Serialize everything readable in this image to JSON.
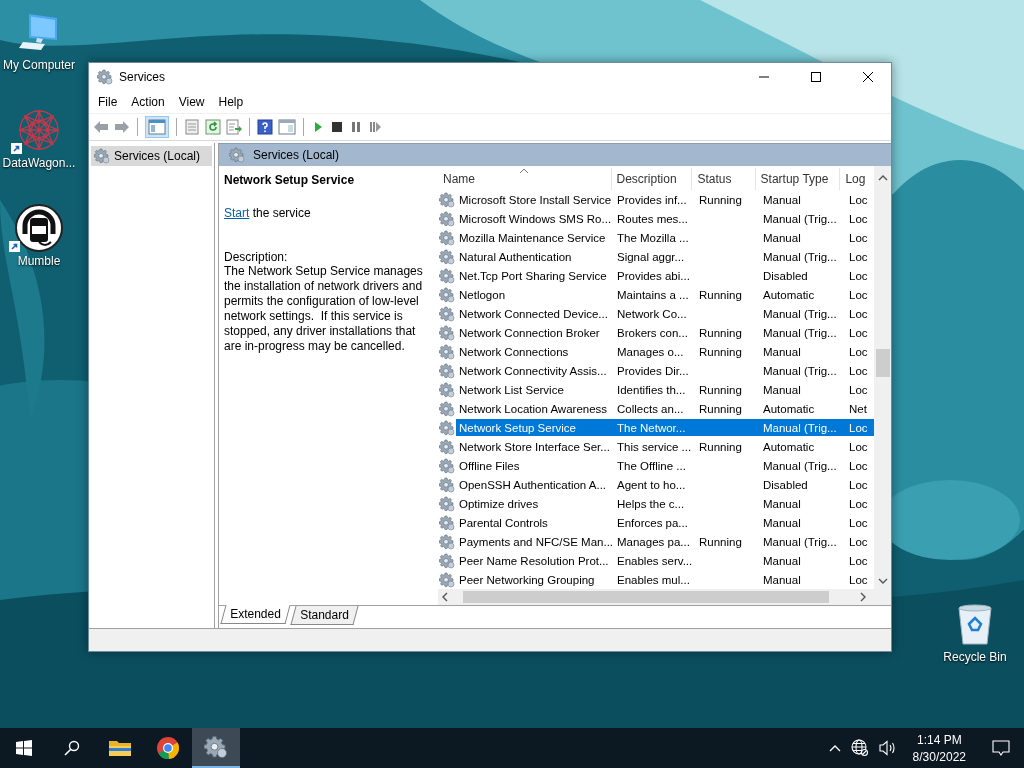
{
  "desktop_icons": [
    {
      "label": "My Computer",
      "kind": "computer",
      "shortcut": false
    },
    {
      "label": "DataWagon...",
      "kind": "mesh",
      "shortcut": true
    },
    {
      "label": "Mumble",
      "kind": "headset",
      "shortcut": true
    }
  ],
  "recycle_bin": {
    "label": "Recycle Bin",
    "kind": "bin"
  },
  "window": {
    "title": "Services",
    "menu": [
      "File",
      "Action",
      "View",
      "Help"
    ],
    "tree": [
      {
        "label": "Services (Local)",
        "selected": true
      }
    ],
    "pane_header": "Services (Local)",
    "detail": {
      "title": "Network Setup Service",
      "link": "Start",
      "link_rest": " the service",
      "description_label": "Description:",
      "description": "The Network Setup Service manages the installation of network drivers and permits the configuration of low-level network settings.  If this service is stopped, any driver installations that are in-progress may be cancelled."
    },
    "table": {
      "columns": [
        {
          "label": "Name",
          "sorted": true
        },
        {
          "label": "Description",
          "sorted": false
        },
        {
          "label": "Status",
          "sorted": false
        },
        {
          "label": "Startup Type",
          "sorted": false
        },
        {
          "label": "Log",
          "sorted": false
        }
      ],
      "rows": [
        {
          "cells": [
            "Microsoft Store Install Service",
            "Provides inf...",
            "Running",
            "Manual",
            "Loc"
          ],
          "selected": false
        },
        {
          "cells": [
            "Microsoft Windows SMS Ro...",
            "Routes mes...",
            "",
            "Manual (Trig...",
            "Loc"
          ],
          "selected": false
        },
        {
          "cells": [
            "Mozilla Maintenance Service",
            "The Mozilla ...",
            "",
            "Manual",
            "Loc"
          ],
          "selected": false
        },
        {
          "cells": [
            "Natural Authentication",
            "Signal aggr...",
            "",
            "Manual (Trig...",
            "Loc"
          ],
          "selected": false
        },
        {
          "cells": [
            "Net.Tcp Port Sharing Service",
            "Provides abi...",
            "",
            "Disabled",
            "Loc"
          ],
          "selected": false
        },
        {
          "cells": [
            "Netlogon",
            "Maintains a ...",
            "Running",
            "Automatic",
            "Loc"
          ],
          "selected": false
        },
        {
          "cells": [
            "Network Connected Device...",
            "Network Co...",
            "",
            "Manual (Trig...",
            "Loc"
          ],
          "selected": false
        },
        {
          "cells": [
            "Network Connection Broker",
            "Brokers con...",
            "Running",
            "Manual (Trig...",
            "Loc"
          ],
          "selected": false
        },
        {
          "cells": [
            "Network Connections",
            "Manages o...",
            "Running",
            "Manual",
            "Loc"
          ],
          "selected": false
        },
        {
          "cells": [
            "Network Connectivity Assis...",
            "Provides Dir...",
            "",
            "Manual (Trig...",
            "Loc"
          ],
          "selected": false
        },
        {
          "cells": [
            "Network List Service",
            "Identifies th...",
            "Running",
            "Manual",
            "Loc"
          ],
          "selected": false
        },
        {
          "cells": [
            "Network Location Awareness",
            "Collects an...",
            "Running",
            "Automatic",
            "Net"
          ],
          "selected": false
        },
        {
          "cells": [
            "Network Setup Service",
            "The Networ...",
            "",
            "Manual (Trig...",
            "Loc"
          ],
          "selected": true
        },
        {
          "cells": [
            "Network Store Interface Ser...",
            "This service ...",
            "Running",
            "Automatic",
            "Loc"
          ],
          "selected": false
        },
        {
          "cells": [
            "Offline Files",
            "The Offline ...",
            "",
            "Manual (Trig...",
            "Loc"
          ],
          "selected": false
        },
        {
          "cells": [
            "OpenSSH Authentication A...",
            "Agent to ho...",
            "",
            "Disabled",
            "Loc"
          ],
          "selected": false
        },
        {
          "cells": [
            "Optimize drives",
            "Helps the c...",
            "",
            "Manual",
            "Loc"
          ],
          "selected": false
        },
        {
          "cells": [
            "Parental Controls",
            "Enforces pa...",
            "",
            "Manual",
            "Loc"
          ],
          "selected": false
        },
        {
          "cells": [
            "Payments and NFC/SE Man...",
            "Manages pa...",
            "Running",
            "Manual (Trig...",
            "Loc"
          ],
          "selected": false
        },
        {
          "cells": [
            "Peer Name Resolution Prot...",
            "Enables serv...",
            "",
            "Manual",
            "Loc"
          ],
          "selected": false
        },
        {
          "cells": [
            "Peer Networking Grouping",
            "Enables mul...",
            "",
            "Manual",
            "Loc"
          ],
          "selected": false
        }
      ]
    },
    "tabs": [
      {
        "label": "Extended",
        "selected": true
      },
      {
        "label": "Standard",
        "selected": false
      }
    ]
  },
  "taskbar": {
    "apps": [
      {
        "kind": "folder",
        "active": false
      },
      {
        "kind": "browser",
        "active": false
      },
      {
        "kind": "gear",
        "active": true
      }
    ],
    "time": "1:14 PM",
    "date": "8/30/2022"
  }
}
